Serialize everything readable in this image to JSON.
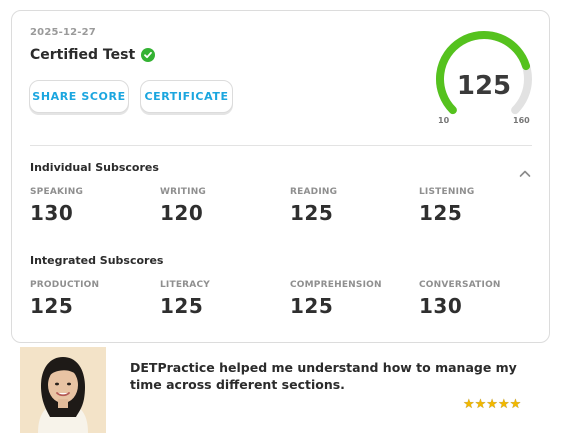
{
  "card": {
    "date": "2025-12-27",
    "title": "Certified Test",
    "share_label": "SHARE SCORE",
    "certificate_label": "CERTIFICATE",
    "gauge": {
      "score": "125",
      "min": "10",
      "max": "160",
      "fill_fraction": 0.77,
      "fill_color": "#55c21e",
      "track_color": "#e2e2e2"
    }
  },
  "individual": {
    "title": "Individual Subscores",
    "items": [
      {
        "label": "SPEAKING",
        "value": "130"
      },
      {
        "label": "WRITING",
        "value": "120"
      },
      {
        "label": "READING",
        "value": "125"
      },
      {
        "label": "LISTENING",
        "value": "125"
      }
    ]
  },
  "integrated": {
    "title": "Integrated Subscores",
    "items": [
      {
        "label": "PRODUCTION",
        "value": "125"
      },
      {
        "label": "LITERACY",
        "value": "125"
      },
      {
        "label": "COMPREHENSION",
        "value": "125"
      },
      {
        "label": "CONVERSATION",
        "value": "130"
      }
    ]
  },
  "testimonial": {
    "quote": "DETPractice helped me understand how to manage my time across different sections.",
    "rating": 5,
    "stars": "★★★★★",
    "avatar_icon": "person-photo"
  },
  "icons": {
    "verified": "check-circle-icon",
    "collapse": "chevron-up-icon"
  }
}
